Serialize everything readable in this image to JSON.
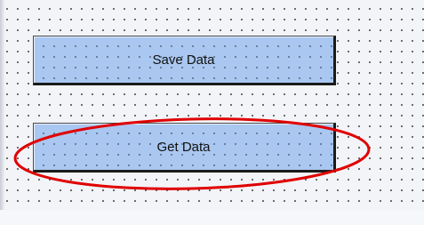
{
  "form": {
    "save_button_label": "Save Data",
    "get_button_label": "Get Data"
  },
  "highlight": {
    "color": "#e00000",
    "target": "get-data-button"
  },
  "colors": {
    "button_face": "#a9c7f0",
    "canvas": "#f2f4f8"
  }
}
